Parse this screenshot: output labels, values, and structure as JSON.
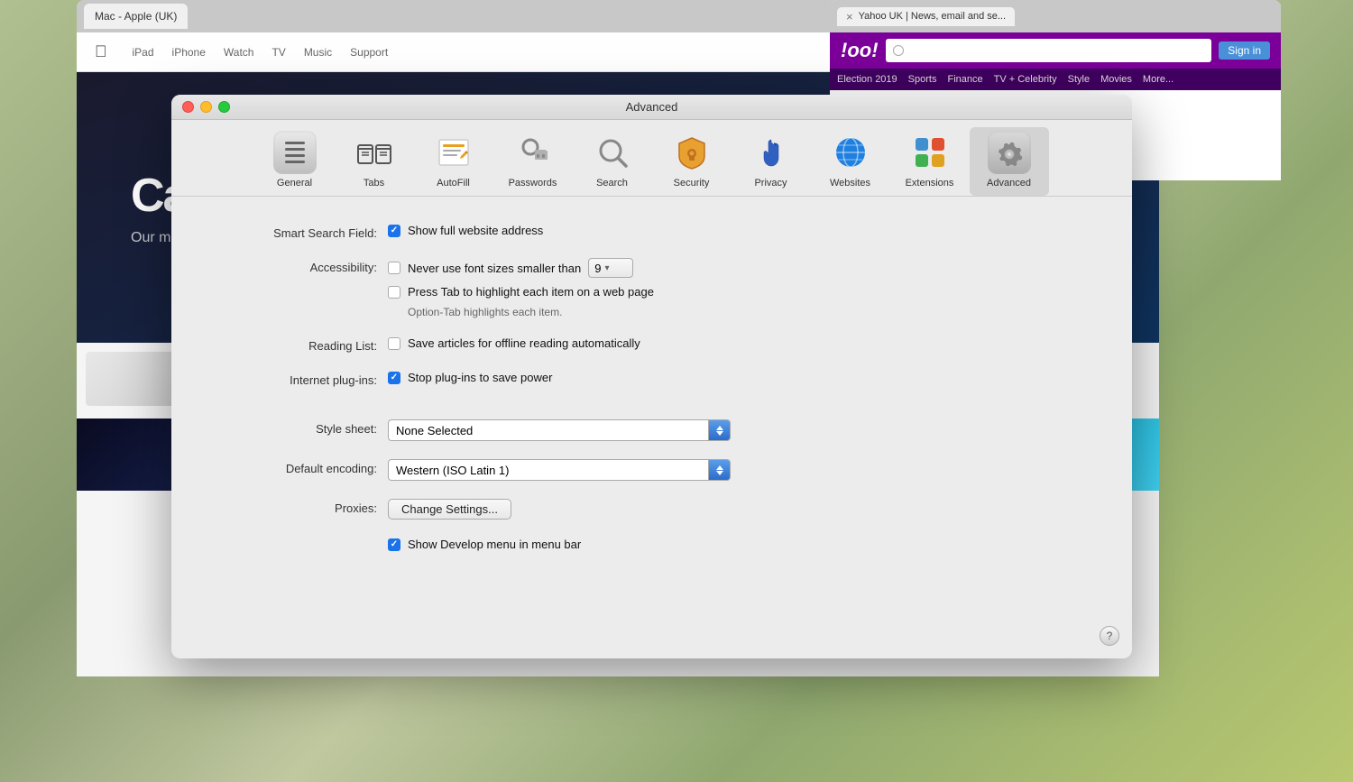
{
  "window": {
    "title": "Advanced",
    "bg_color": "#7a8a6a"
  },
  "tabs": {
    "tab1": {
      "label": "Mac - Apple (UK)",
      "active": false
    },
    "tab2": {
      "label": "Yahoo UK | News, email and se...",
      "active": false,
      "close_symbol": "×"
    }
  },
  "toolbar": {
    "items": [
      {
        "id": "general",
        "label": "General"
      },
      {
        "id": "tabs",
        "label": "Tabs"
      },
      {
        "id": "autofill",
        "label": "AutoFill"
      },
      {
        "id": "passwords",
        "label": "Passwords"
      },
      {
        "id": "search",
        "label": "Search"
      },
      {
        "id": "security",
        "label": "Security"
      },
      {
        "id": "privacy",
        "label": "Privacy"
      },
      {
        "id": "websites",
        "label": "Websites"
      },
      {
        "id": "extensions",
        "label": "Extensions"
      },
      {
        "id": "advanced",
        "label": "Advanced",
        "active": true
      }
    ]
  },
  "settings": {
    "smart_search_field": {
      "label": "Smart Search Field:",
      "options": [
        {
          "id": "show_full_address",
          "text": "Show full website address",
          "checked": true
        }
      ]
    },
    "accessibility": {
      "label": "Accessibility:",
      "options": [
        {
          "id": "never_small_font",
          "text": "Never use font sizes smaller than",
          "checked": false,
          "has_stepper": true,
          "stepper_value": "9"
        },
        {
          "id": "press_tab",
          "text": "Press Tab to highlight each item on a web page",
          "checked": false,
          "note": "Option-Tab highlights each item."
        }
      ]
    },
    "reading_list": {
      "label": "Reading List:",
      "options": [
        {
          "id": "save_offline",
          "text": "Save articles for offline reading automatically",
          "checked": false
        }
      ]
    },
    "internet_plugins": {
      "label": "Internet plug-ins:",
      "options": [
        {
          "id": "stop_plugins",
          "text": "Stop plug-ins to save power",
          "checked": true
        }
      ]
    },
    "style_sheet": {
      "label": "Style sheet:",
      "value": "None Selected",
      "dropdown_width": 380
    },
    "default_encoding": {
      "label": "Default encoding:",
      "value": "Western (ISO Latin 1)",
      "dropdown_width": 380
    },
    "proxies": {
      "label": "Proxies:",
      "button_label": "Change Settings..."
    },
    "develop_menu": {
      "id": "show_develop",
      "text": "Show Develop menu in menu bar",
      "checked": true
    }
  },
  "help_button": "?",
  "apple_page": {
    "title": "Ca",
    "subtitle": "Our most powerfu\nPro Display"
  },
  "yahoo_page": {
    "title": "Yahoo UK | News, email and se...",
    "logo": "oo!"
  }
}
